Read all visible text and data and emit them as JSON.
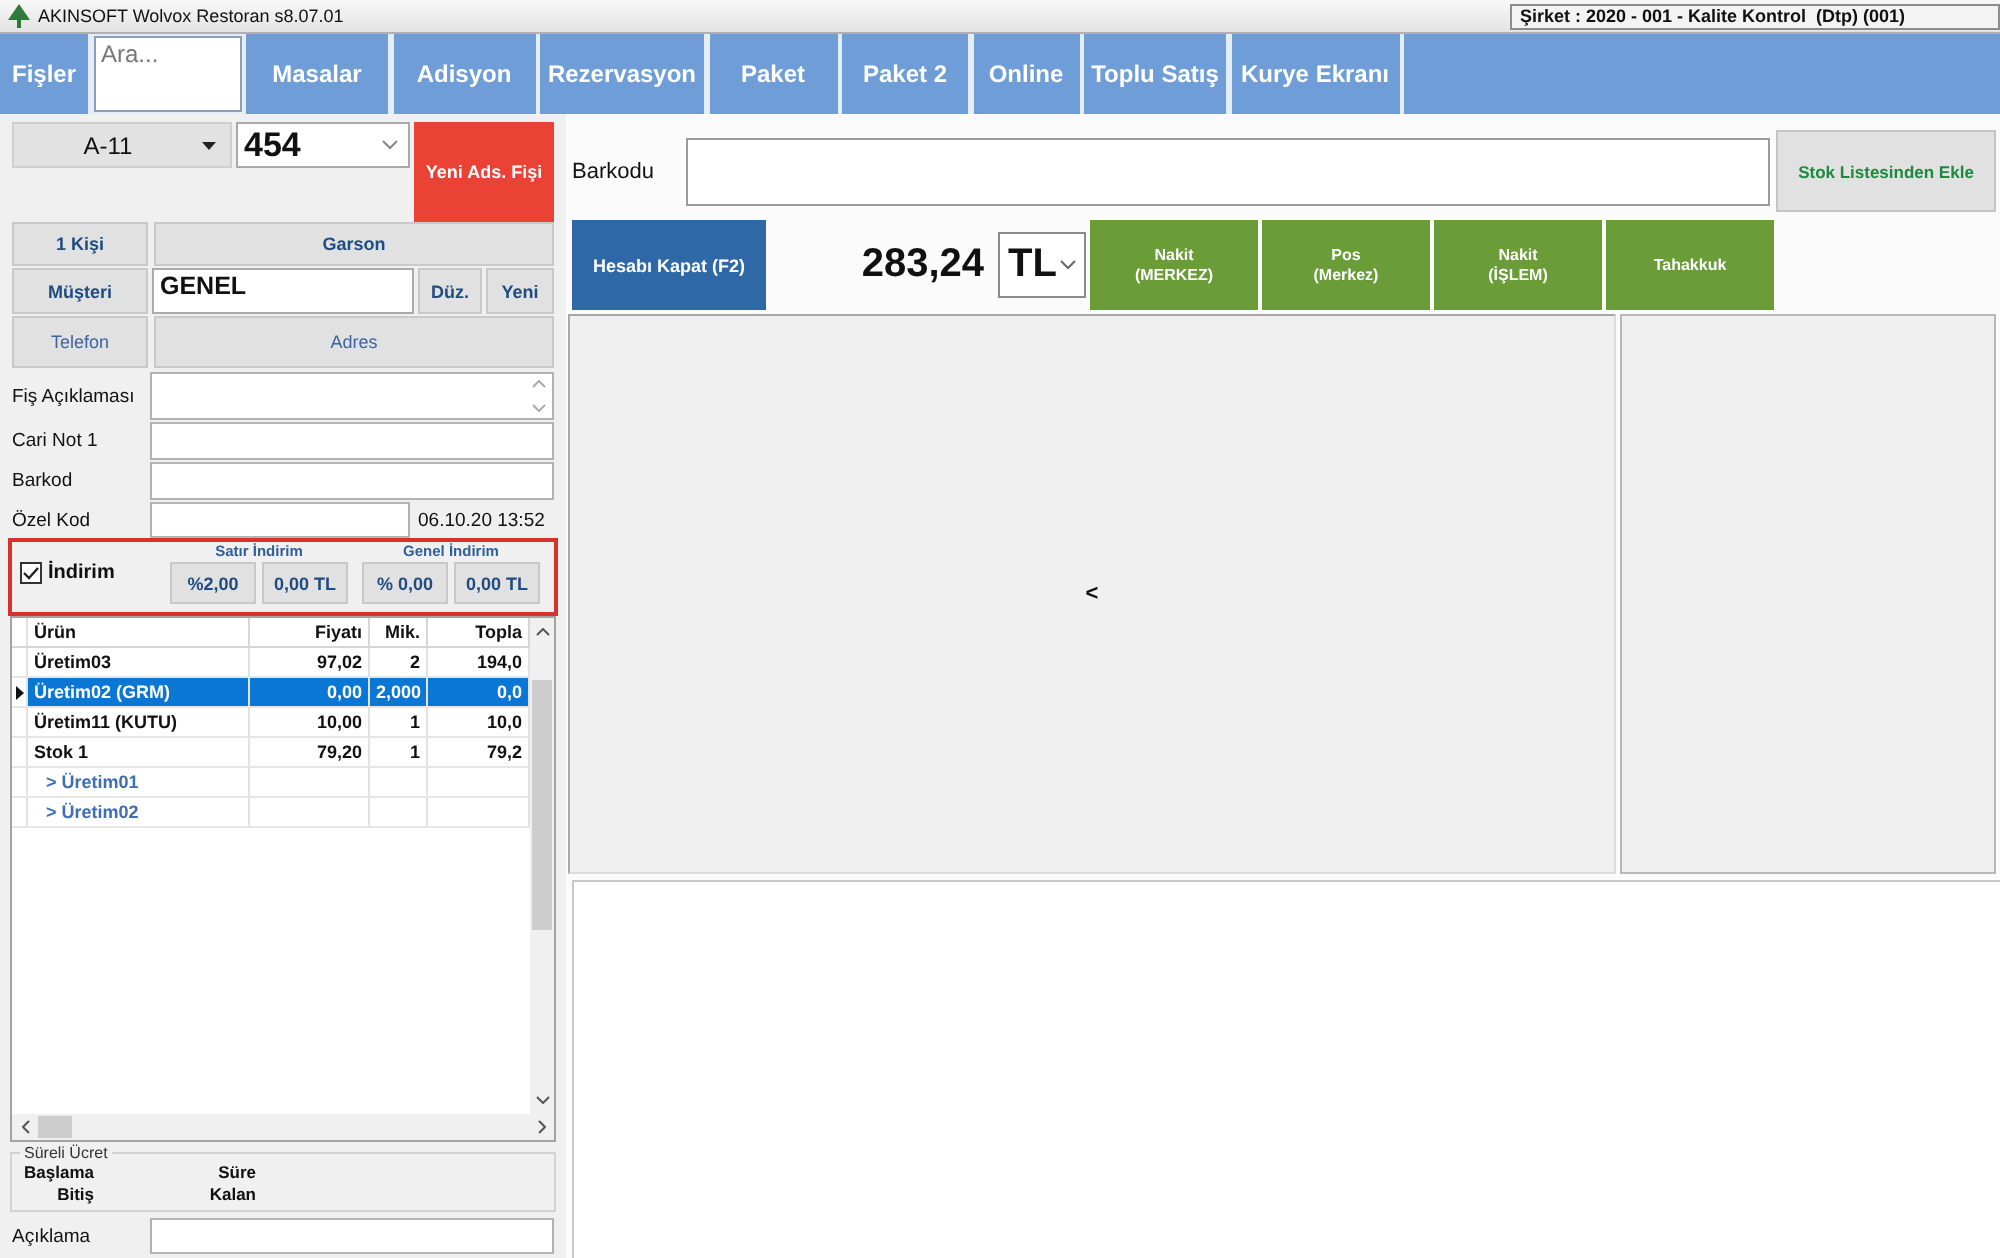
{
  "title_bar": {
    "app_title": "AKINSOFT Wolvox Restoran s8.07.01",
    "company": "Şirket : 2020 - 001 - Kalite Kontrol  (Dtp) (001)"
  },
  "nav": {
    "items": [
      {
        "kind": "button",
        "label": "Fişler"
      },
      {
        "kind": "search",
        "placeholder": "Ara..."
      },
      {
        "kind": "button",
        "label": "Masalar"
      },
      {
        "kind": "button",
        "label": "Adisyon"
      },
      {
        "kind": "button",
        "label": "Rezervasyon"
      },
      {
        "kind": "button",
        "label": "Paket"
      },
      {
        "kind": "button",
        "label": "Paket 2"
      },
      {
        "kind": "button",
        "label": "Online"
      },
      {
        "kind": "button",
        "label": "Toplu Satış"
      },
      {
        "kind": "button",
        "label": "Kurye Ekranı"
      }
    ]
  },
  "order": {
    "table": "A-11",
    "receipt_no": "454",
    "new_receipt_button": "Yeni Ads. Fişi",
    "guests_button": "1 Kişi",
    "waiter_button": "Garson",
    "customer_button": "Müşteri",
    "customer": "GENEL",
    "edit_button": "Düz.",
    "new_customer_button": "Yeni",
    "phone_button": "Telefon",
    "address_button": "Adres"
  },
  "fields": [
    {
      "label": "Fiş Açıklaması",
      "kind": "textarea"
    },
    {
      "label": "Cari Not 1",
      "kind": "input"
    },
    {
      "label": "Barkod",
      "kind": "input"
    },
    {
      "label": "Özel Kod",
      "kind": "input",
      "side_text": "06.10.20 13:52"
    }
  ],
  "discount": {
    "checkbox": {
      "label": "İndirim",
      "checked": true
    },
    "groups": [
      {
        "title": "Satır İndirim",
        "buttons": [
          "%2,00",
          "0,00 TL"
        ]
      },
      {
        "title": "Genel İndirim",
        "buttons": [
          "% 0,00",
          "0,00 TL"
        ]
      }
    ]
  },
  "grid": {
    "columns": [
      "Ürün",
      "Fiyatı",
      "Mik.",
      "Topla"
    ],
    "rows": [
      {
        "name": "Üretim03",
        "price": "97,02",
        "qty": "2",
        "total": "194,0",
        "selected": false
      },
      {
        "name": "Üretim02 (GRM)",
        "price": "0,00",
        "qty": "2,000",
        "total": "0,0",
        "selected": true
      },
      {
        "name": "Üretim11 (KUTU)",
        "price": "10,00",
        "qty": "1",
        "total": "10,0",
        "selected": false
      },
      {
        "name": "Stok 1",
        "price": "79,20",
        "qty": "1",
        "total": "79,2",
        "selected": false,
        "children": [
          {
            "name": "> Üretim01",
            "selected": false
          },
          {
            "name": "> Üretim02",
            "selected": false
          }
        ]
      }
    ]
  },
  "timed_fee": {
    "title": "Süreli Ücret",
    "labels": [
      "Başlama",
      "Süre",
      "Bitiş",
      "Kalan"
    ]
  },
  "note": {
    "label": "Açıklama"
  },
  "barcode": {
    "label": "Barkodu",
    "add_button": "Stok Listesinden Ekle"
  },
  "payment": {
    "close_button": "Hesabı Kapat (F2)",
    "total": "283,24",
    "currency": "TL",
    "methods": [
      "Nakit\n(MERKEZ)",
      "Pos\n(Merkez)",
      "Nakit\n(İŞLEM)",
      "Tahakkuk"
    ]
  },
  "item_panel": {
    "collapse_glyph": "<"
  }
}
